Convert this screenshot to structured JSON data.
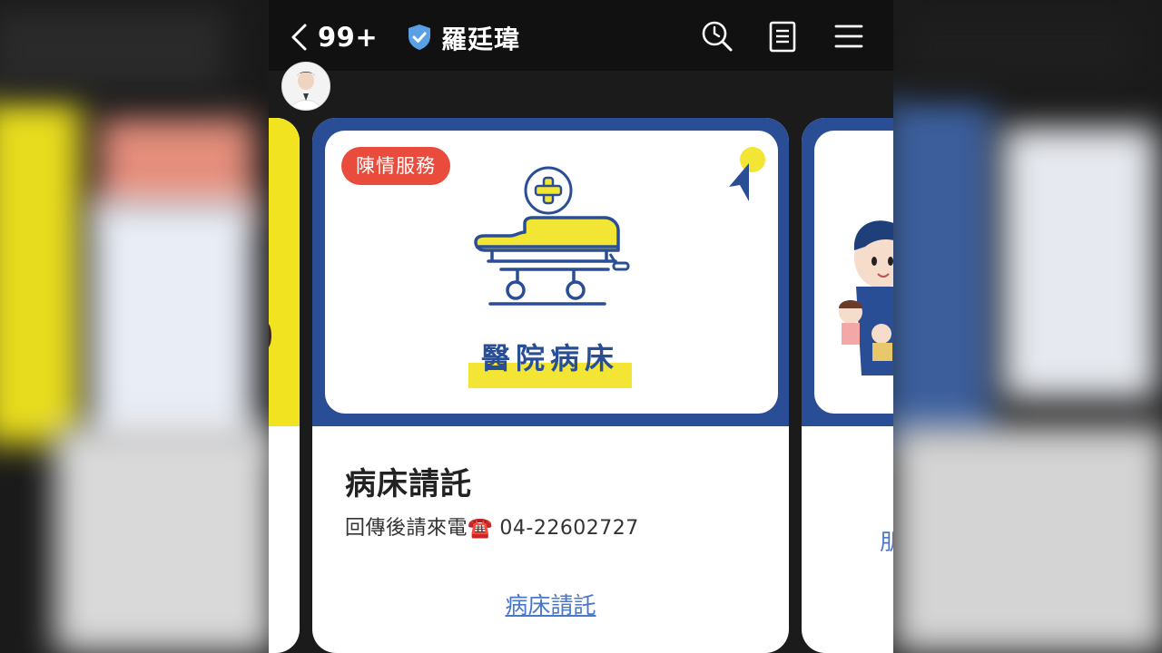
{
  "topbar": {
    "unread_count": "99+",
    "account_name": "羅廷瑋",
    "icons": [
      "back-chevron-icon",
      "verified-shield-icon",
      "search-icon",
      "notes-icon",
      "menu-icon"
    ]
  },
  "carousel": {
    "main_card": {
      "tag": "陳情服務",
      "image_caption": "醫院病床",
      "title": "病床請託",
      "description": "回傳後請來電☎️ 04-22602727",
      "link_label": "病床請託"
    },
    "right_card": {
      "partial_link_label": "朋"
    }
  },
  "colors": {
    "brand_blue": "#2a4e96",
    "tag_red": "#e94c3d",
    "highlight_yellow": "#f2e534",
    "link_blue": "#4a77c9"
  }
}
